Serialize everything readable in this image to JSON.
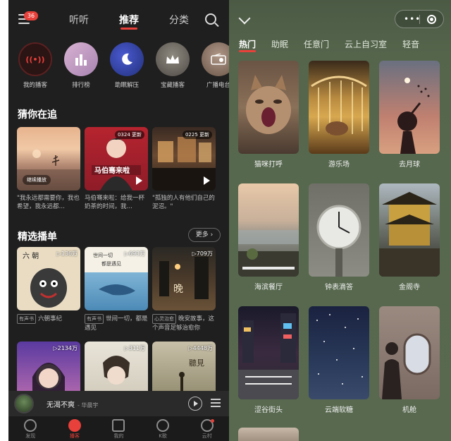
{
  "left": {
    "badge": "36",
    "tabs": [
      "听听",
      "推荐",
      "分类"
    ],
    "quick": [
      {
        "label": "我的播客",
        "icon": "radio-wave-icon",
        "color": "#2a1414",
        "glyph": "((•))"
      },
      {
        "label": "排行榜",
        "icon": "bar-chart-icon",
        "color": "#c9a2c4",
        "glyph": "▮▮▮"
      },
      {
        "label": "助眠解压",
        "icon": "moon-icon",
        "color": "#2f3d8e",
        "glyph": "☾"
      },
      {
        "label": "宝藏播客",
        "icon": "crown-icon",
        "color": "#6f6a63",
        "glyph": "♛"
      },
      {
        "label": "广播电台",
        "icon": "radio-icon",
        "color": "#8f7565",
        "glyph": "中"
      }
    ],
    "section1": "猜你在追",
    "tracking": [
      {
        "caption": "\"我永远都需要你，我也希望，我永远都…",
        "badge": "",
        "button": "继续播放"
      },
      {
        "caption": "马伯骞来啦：给我一杯奶茶的时间，我…",
        "badge": "0324 更新",
        "button": ""
      },
      {
        "caption": "\"孤独的人有他们自己的泥沼。\"",
        "badge": "0225 更新",
        "button": ""
      }
    ],
    "section2": "精选播单",
    "more": "更多",
    "playlists": [
      {
        "count": "▷136万",
        "tag": "有声书",
        "title": "六朝事纪"
      },
      {
        "count": "▷693万",
        "tag": "有声书",
        "title": "世间一切，都是遇见"
      },
      {
        "count": "▷709万",
        "tag": "心灵治愈",
        "title": "晚安故事，这个声音足够治愈你"
      }
    ],
    "playlists2": [
      {
        "count": "▷2134万"
      },
      {
        "count": "▷311万"
      },
      {
        "count": "▷4448万"
      }
    ],
    "player": {
      "title": "无渴不爽",
      "artist": "- 华晨宇"
    },
    "nav": [
      "发现",
      "播客",
      "我的",
      "K歌",
      "云村"
    ]
  },
  "right": {
    "tabs": [
      "热门",
      "助眠",
      "任意门",
      "云上自习室",
      "轻音"
    ],
    "items": [
      "猫咪打呼",
      "游乐场",
      "去月球",
      "海滨餐厅",
      "钟表滴答",
      "金阁寺",
      "涩谷街头",
      "云端软糖",
      "机舱"
    ]
  }
}
